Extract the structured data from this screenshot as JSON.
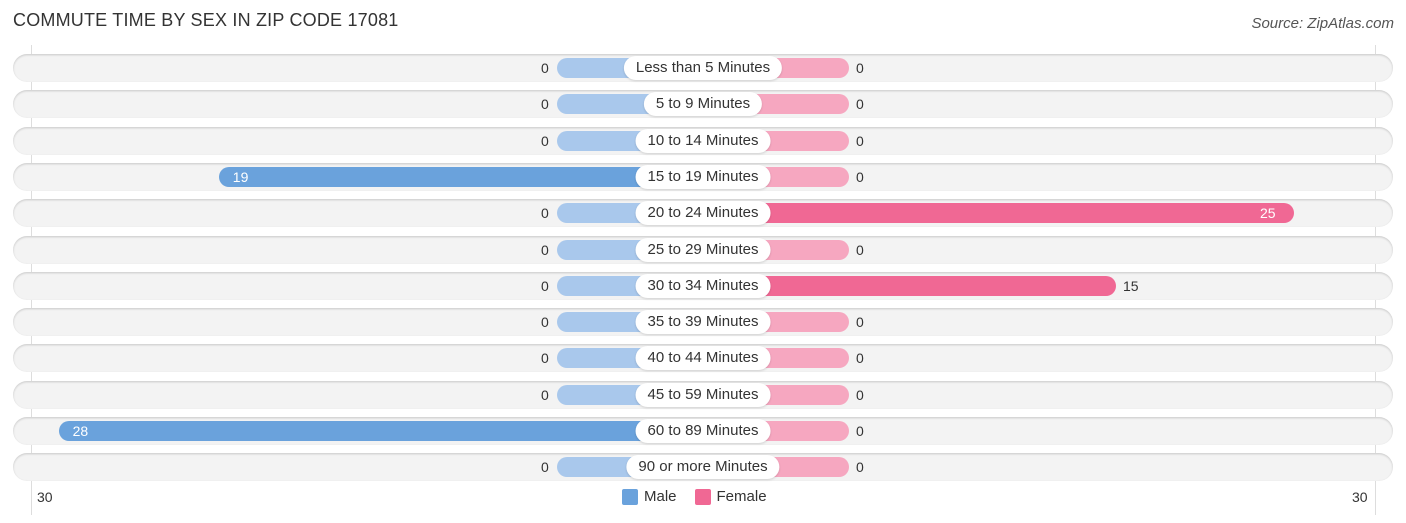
{
  "header": {
    "title": "COMMUTE TIME BY SEX IN ZIP CODE 17081",
    "source": "Source: ZipAtlas.com"
  },
  "chart_data": {
    "type": "bar",
    "orientation": "horizontal-diverging",
    "title": "COMMUTE TIME BY SEX IN ZIP CODE 17081",
    "categories": [
      "Less than 5 Minutes",
      "5 to 9 Minutes",
      "10 to 14 Minutes",
      "15 to 19 Minutes",
      "20 to 24 Minutes",
      "25 to 29 Minutes",
      "30 to 34 Minutes",
      "35 to 39 Minutes",
      "40 to 44 Minutes",
      "45 to 59 Minutes",
      "60 to 89 Minutes",
      "90 or more Minutes"
    ],
    "series": [
      {
        "name": "Male",
        "color": "#6aa2dc",
        "values": [
          0,
          0,
          0,
          19,
          0,
          0,
          0,
          0,
          0,
          0,
          28,
          0
        ]
      },
      {
        "name": "Female",
        "color": "#f06894",
        "values": [
          0,
          0,
          0,
          0,
          25,
          0,
          15,
          0,
          0,
          0,
          0,
          0
        ]
      }
    ],
    "xlim": [
      30,
      30
    ],
    "axis_ticks": {
      "left": "30",
      "right": "30"
    },
    "legend": {
      "position": "bottom-center",
      "entries": [
        "Male",
        "Female"
      ]
    }
  },
  "colors": {
    "male_light": "#a9c8ec",
    "male_strong": "#6aa2dc",
    "female_light": "#f6a7c0",
    "female_strong": "#f06894"
  }
}
